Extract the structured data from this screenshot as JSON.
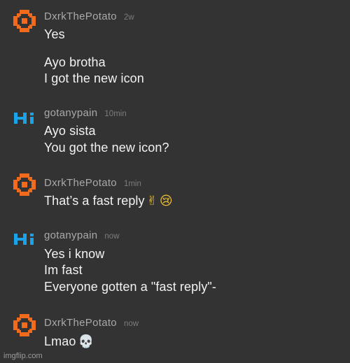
{
  "messages": [
    {
      "username": "DxrkThePotato",
      "time": "2w",
      "avatar": "potato-logo",
      "lines": [
        "Yes",
        "Ayo brotha",
        "I got the new icon"
      ],
      "emoji": []
    },
    {
      "username": "gotanypain",
      "time": "10min",
      "avatar": "hi-logo",
      "lines": [
        "Ayo sista",
        "You got the new icon?"
      ],
      "emoji": []
    },
    {
      "username": "DxrkThePotato",
      "time": "1min",
      "avatar": "potato-logo",
      "lines": [
        "That’s a fast reply"
      ],
      "emoji": [
        "✌",
        "😢"
      ]
    },
    {
      "username": "gotanypain",
      "time": "now",
      "avatar": "hi-logo",
      "lines": [
        "Yes i know",
        "Im fast",
        "Everyone gotten a \"fast reply\"-"
      ],
      "emoji": []
    },
    {
      "username": "DxrkThePotato",
      "time": "now",
      "avatar": "potato-logo",
      "lines": [
        "Lmao"
      ],
      "emoji": [
        "💀"
      ]
    }
  ],
  "watermark": "imgflip.com",
  "colors": {
    "background": "#333333",
    "potato_orange": "#f26a1b",
    "hi_blue": "#1aa3e8",
    "username": "#a9a9a9",
    "message_text": "#f2f2f2"
  }
}
